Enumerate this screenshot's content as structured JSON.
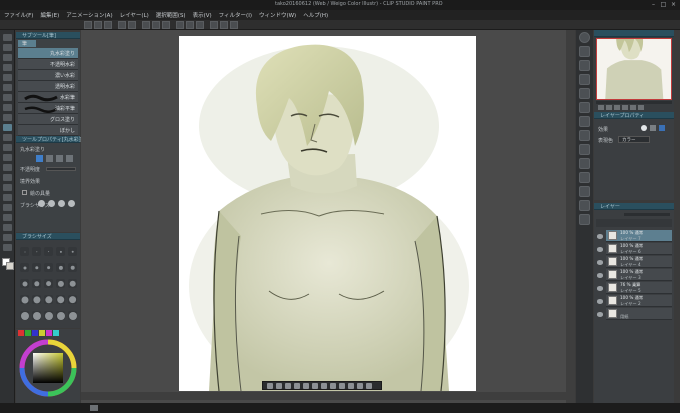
{
  "window": {
    "title": "tako20160612 (Web / Weigo Color Illustr) - CLIP STUDIO PAINT PRO",
    "minimize_glyph": "–",
    "maximize_glyph": "□",
    "close_glyph": "×"
  },
  "menu": [
    "ファイル(F)",
    "編集(E)",
    "アニメーション(A)",
    "レイヤー(L)",
    "選択範囲(S)",
    "表示(V)",
    "フィルター(I)",
    "ウィンドウ(W)",
    "ヘルプ(H)"
  ],
  "subtool": {
    "header": "サブツール[筆]",
    "tab": "筆",
    "items": [
      "丸水彩塗り",
      "不透明水彩",
      "濃い水彩",
      "透明水彩",
      "水彩筆",
      "油彩平筆",
      "グロス塗り",
      "ぼかし"
    ]
  },
  "tool_property": {
    "header": "ツールプロパティ[丸水彩塗り]",
    "title": "丸水彩塗り",
    "row1": "不透明度",
    "row2": "境界効果",
    "row3": "絵の具量",
    "row4": "ブラシサイズ"
  },
  "brush_size": {
    "header": "ブラシサイズ"
  },
  "layer_property": {
    "header": "レイヤープロパティ",
    "effect_label": "効果",
    "color_label": "表現色",
    "color_value": "カラー"
  },
  "layers": {
    "header": "レイヤー",
    "items": [
      {
        "name": "100 % 通常",
        "sub": "レイヤー 7"
      },
      {
        "name": "100 % 通常",
        "sub": "レイヤー 6"
      },
      {
        "name": "100 % 通常",
        "sub": "レイヤー 4"
      },
      {
        "name": "100 % 通常",
        "sub": "レイヤー 3"
      },
      {
        "name": "76 % 乗算",
        "sub": "レイヤー 5"
      },
      {
        "name": "100 % 通常",
        "sub": "レイヤー 2"
      },
      {
        "name": "",
        "sub": "用紙"
      }
    ]
  },
  "colors": {
    "accent": "#5b7f8f",
    "panel": "#3d4144",
    "paper": "#ffffff",
    "sketch_tint": "#c7c9a7"
  }
}
